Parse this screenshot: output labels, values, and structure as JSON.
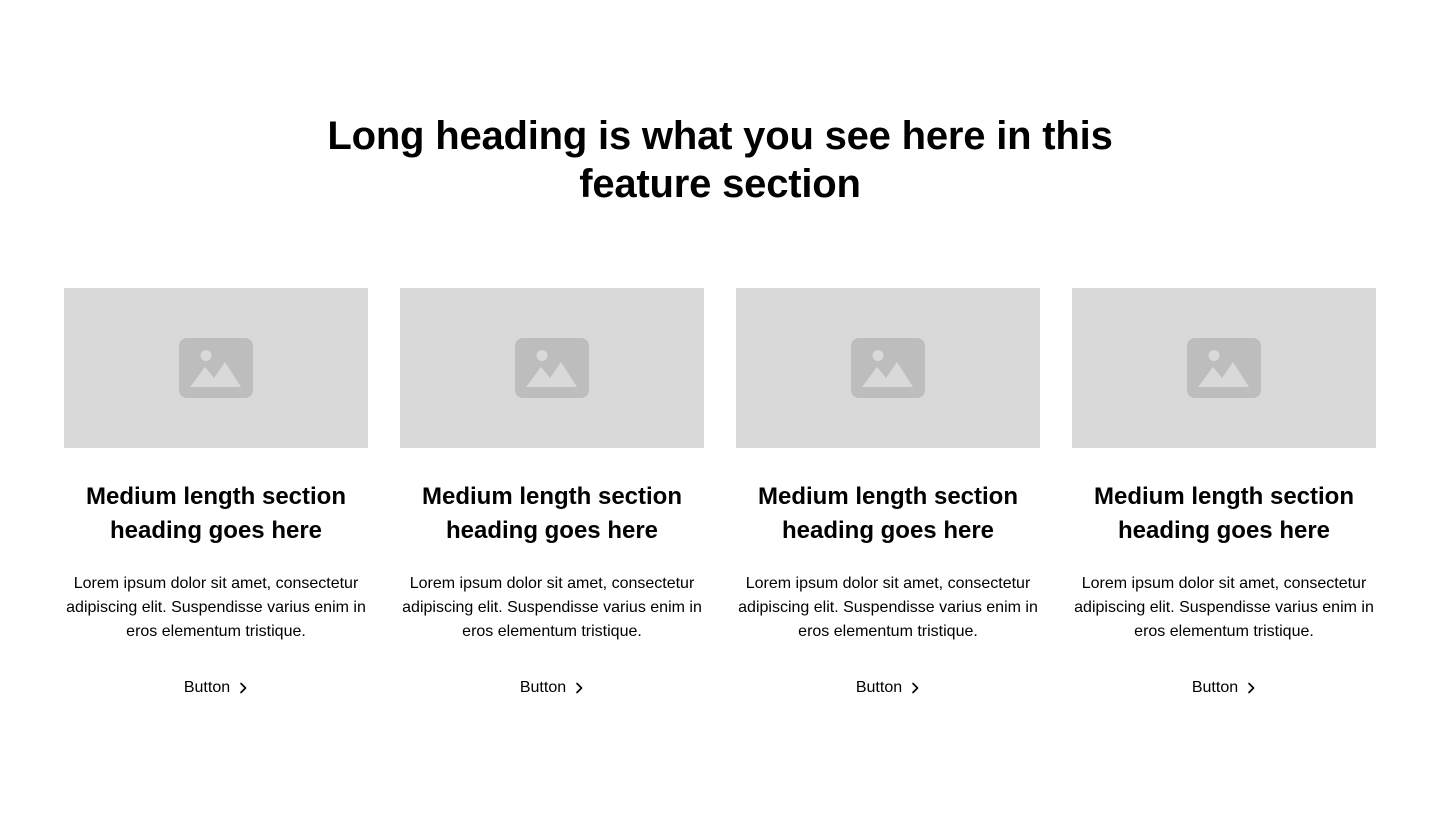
{
  "section": {
    "heading": "Long heading is what you see here in this feature section"
  },
  "cards": [
    {
      "heading": "Medium length section heading goes here",
      "body": "Lorem ipsum dolor sit amet, consectetur adipiscing elit. Suspendisse varius enim in eros elementum tristique.",
      "button_label": "Button",
      "image_icon": "image-placeholder-icon",
      "button_icon": "chevron-right-icon"
    },
    {
      "heading": "Medium length section heading goes here",
      "body": "Lorem ipsum dolor sit amet, consectetur adipiscing elit. Suspendisse varius enim in eros elementum tristique.",
      "button_label": "Button",
      "image_icon": "image-placeholder-icon",
      "button_icon": "chevron-right-icon"
    },
    {
      "heading": "Medium length section heading goes here",
      "body": "Lorem ipsum dolor sit amet, consectetur adipiscing elit. Suspendisse varius enim in eros elementum tristique.",
      "button_label": "Button",
      "image_icon": "image-placeholder-icon",
      "button_icon": "chevron-right-icon"
    },
    {
      "heading": "Medium length section heading goes here",
      "body": "Lorem ipsum dolor sit amet, consectetur adipiscing elit. Suspendisse varius enim in eros elementum tristique.",
      "button_label": "Button",
      "image_icon": "image-placeholder-icon",
      "button_icon": "chevron-right-icon"
    }
  ],
  "colors": {
    "background": "#ffffff",
    "text": "#000000",
    "placeholder_bg": "#d9d9d9",
    "placeholder_icon": "#bdbdbd"
  }
}
